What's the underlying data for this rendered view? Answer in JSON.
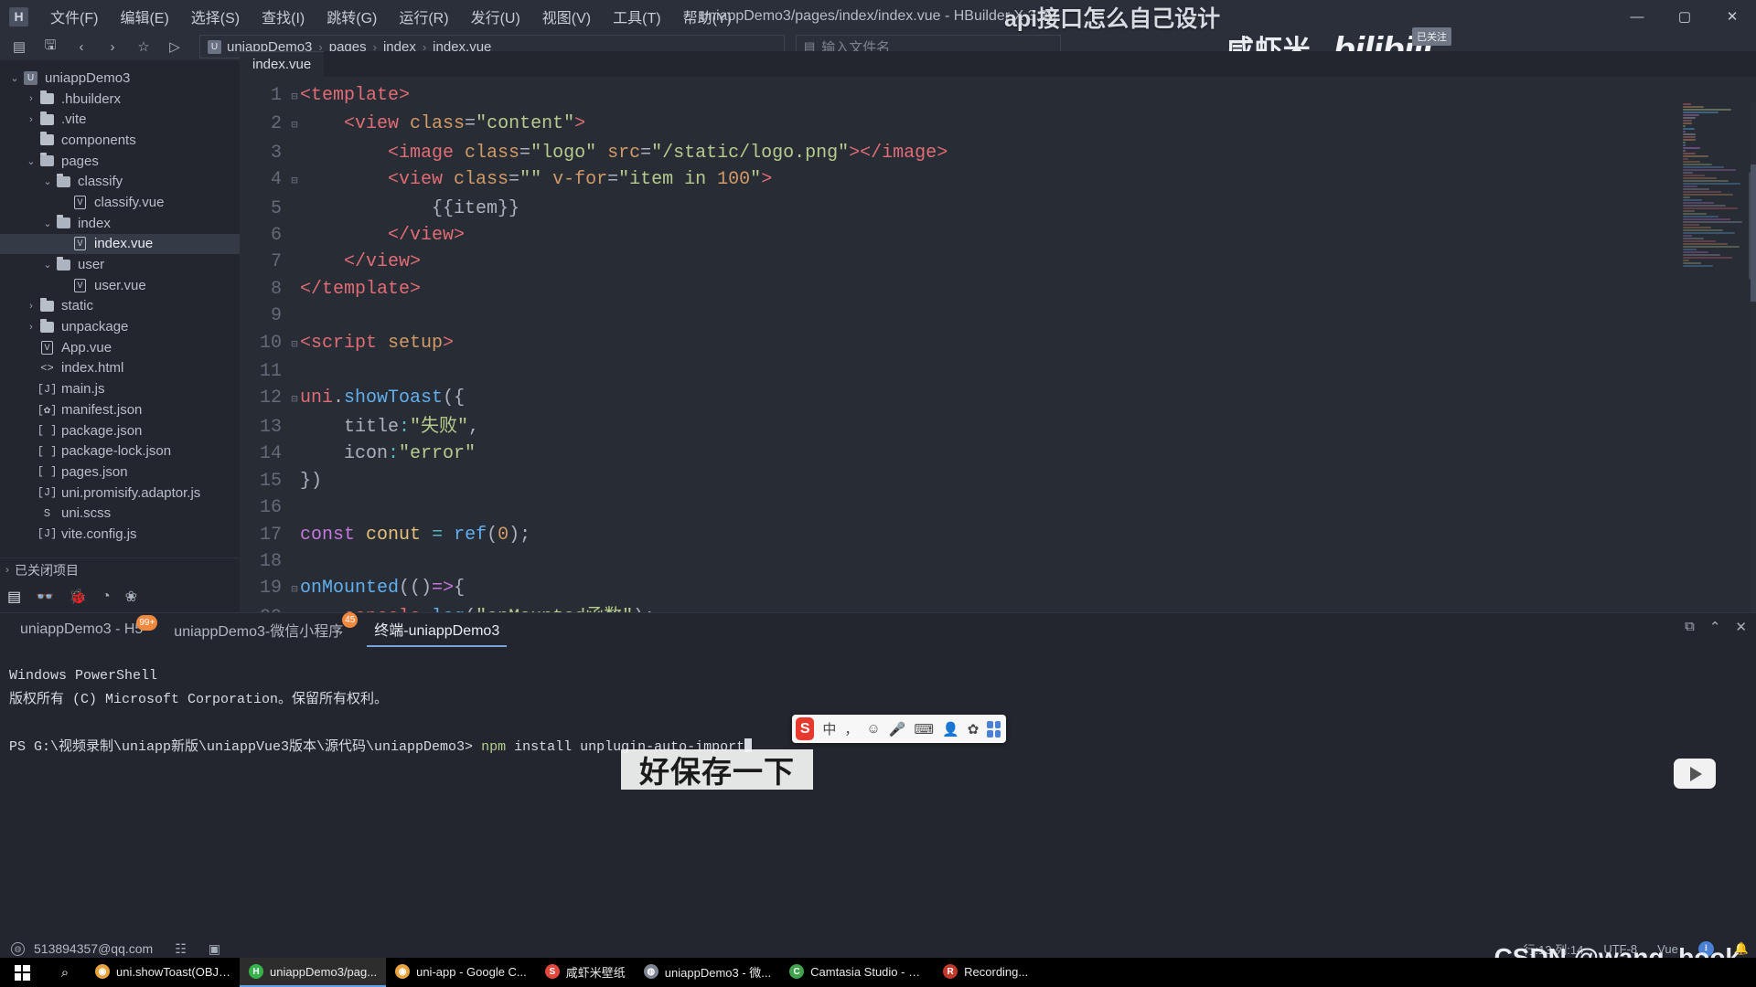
{
  "titlebar": {
    "logo": "H",
    "window_title": "uniappDemo3/pages/index/index.vue - HBuilder X 3.98",
    "overlay_title": "api接口怎么自己设计",
    "menus": [
      "文件(F)",
      "编辑(E)",
      "选择(S)",
      "查找(I)",
      "跳转(G)",
      "运行(R)",
      "发行(U)",
      "视图(V)",
      "工具(T)",
      "帮助(Y)"
    ],
    "minimize": "—",
    "maximize": "▢",
    "close": "✕"
  },
  "toolbar": {
    "icons": [
      "sidebar-toggle-icon",
      "save-icon",
      "back-icon",
      "forward-icon",
      "star-icon",
      "run-icon"
    ],
    "glyphs": [
      "▤",
      "🖫",
      "‹",
      "›",
      "☆",
      "▷"
    ],
    "project_icon": "U",
    "breadcrumb": [
      "uniappDemo3",
      "pages",
      "index",
      "index.vue"
    ],
    "breadcrumb_sep": "›",
    "filename_icon": "▤",
    "filename_placeholder": "输入文件名"
  },
  "brand": {
    "cn_text": "咸虾米_",
    "bili_text": "bilibili",
    "badge": "已关注"
  },
  "sidebar": {
    "tree": [
      {
        "depth": 0,
        "arrow": "⌄",
        "icon": "project-icon",
        "glyph": "U",
        "label": "uniappDemo3",
        "selected": false
      },
      {
        "depth": 1,
        "arrow": "›",
        "icon": "folder-icon",
        "glyph": "",
        "label": ".hbuilderx",
        "selected": false
      },
      {
        "depth": 1,
        "arrow": "›",
        "icon": "folder-icon",
        "glyph": "",
        "label": ".vite",
        "selected": false
      },
      {
        "depth": 1,
        "arrow": "",
        "icon": "folder-icon",
        "glyph": "",
        "label": "components",
        "selected": false
      },
      {
        "depth": 1,
        "arrow": "⌄",
        "icon": "folder-icon",
        "glyph": "",
        "label": "pages",
        "selected": false
      },
      {
        "depth": 2,
        "arrow": "⌄",
        "icon": "folder-icon",
        "glyph": "",
        "label": "classify",
        "selected": false
      },
      {
        "depth": 3,
        "arrow": "",
        "icon": "vue-file-icon",
        "glyph": "V",
        "label": "classify.vue",
        "selected": false
      },
      {
        "depth": 2,
        "arrow": "⌄",
        "icon": "folder-icon",
        "glyph": "",
        "label": "index",
        "selected": false
      },
      {
        "depth": 3,
        "arrow": "",
        "icon": "vue-file-icon",
        "glyph": "V",
        "label": "index.vue",
        "selected": true
      },
      {
        "depth": 2,
        "arrow": "⌄",
        "icon": "folder-icon",
        "glyph": "",
        "label": "user",
        "selected": false
      },
      {
        "depth": 3,
        "arrow": "",
        "icon": "vue-file-icon",
        "glyph": "V",
        "label": "user.vue",
        "selected": false
      },
      {
        "depth": 1,
        "arrow": "›",
        "icon": "folder-icon",
        "glyph": "",
        "label": "static",
        "selected": false
      },
      {
        "depth": 1,
        "arrow": "›",
        "icon": "folder-icon",
        "glyph": "",
        "label": "unpackage",
        "selected": false
      },
      {
        "depth": 1,
        "arrow": "",
        "icon": "vue-file-icon",
        "glyph": "V",
        "label": "App.vue",
        "selected": false
      },
      {
        "depth": 1,
        "arrow": "",
        "icon": "html-file-icon",
        "glyph": "<>",
        "label": "index.html",
        "selected": false
      },
      {
        "depth": 1,
        "arrow": "",
        "icon": "js-file-icon",
        "glyph": "[J]",
        "label": "main.js",
        "selected": false
      },
      {
        "depth": 1,
        "arrow": "",
        "icon": "json-gear-icon",
        "glyph": "[✿]",
        "label": "manifest.json",
        "selected": false
      },
      {
        "depth": 1,
        "arrow": "",
        "icon": "json-file-icon",
        "glyph": "[ ]",
        "label": "package.json",
        "selected": false
      },
      {
        "depth": 1,
        "arrow": "",
        "icon": "json-file-icon",
        "glyph": "[ ]",
        "label": "package-lock.json",
        "selected": false
      },
      {
        "depth": 1,
        "arrow": "",
        "icon": "json-file-icon",
        "glyph": "[ ]",
        "label": "pages.json",
        "selected": false
      },
      {
        "depth": 1,
        "arrow": "",
        "icon": "js-file-icon",
        "glyph": "[J]",
        "label": "uni.promisify.adaptor.js",
        "selected": false
      },
      {
        "depth": 1,
        "arrow": "",
        "icon": "scss-file-icon",
        "glyph": "S",
        "label": "uni.scss",
        "selected": false
      },
      {
        "depth": 1,
        "arrow": "",
        "icon": "js-file-icon",
        "glyph": "[J]",
        "label": "vite.config.js",
        "selected": false
      }
    ],
    "closed_projects": {
      "arrow": "›",
      "label": "已关闭项目"
    },
    "tools": [
      {
        "name": "explorer-icon",
        "glyph": "▤"
      },
      {
        "name": "search-icon",
        "glyph": "👓"
      },
      {
        "name": "debug-icon",
        "glyph": "🐞"
      },
      {
        "name": "terminal-icon",
        "glyph": "◔"
      },
      {
        "name": "extension-icon",
        "glyph": "❀"
      }
    ]
  },
  "editor": {
    "tab_label": "index.vue",
    "lines": [
      {
        "n": "1",
        "fold": "⊟",
        "tokens": [
          {
            "t": "tag",
            "v": "<template>"
          }
        ]
      },
      {
        "n": "2",
        "fold": "⊟",
        "tokens": [
          {
            "t": "plain",
            "v": "    "
          },
          {
            "t": "tag",
            "v": "<view "
          },
          {
            "t": "attr",
            "v": "class"
          },
          {
            "t": "punc",
            "v": "="
          },
          {
            "t": "str",
            "v": "\"content\""
          },
          {
            "t": "tag",
            "v": ">"
          }
        ]
      },
      {
        "n": "3",
        "fold": "",
        "tokens": [
          {
            "t": "plain",
            "v": "        "
          },
          {
            "t": "tag",
            "v": "<image "
          },
          {
            "t": "attr",
            "v": "class"
          },
          {
            "t": "punc",
            "v": "="
          },
          {
            "t": "str",
            "v": "\"logo\""
          },
          {
            "t": "plain",
            "v": " "
          },
          {
            "t": "attr",
            "v": "src"
          },
          {
            "t": "punc",
            "v": "="
          },
          {
            "t": "str",
            "v": "\"/static/logo.png\""
          },
          {
            "t": "tag",
            "v": "></image>"
          }
        ]
      },
      {
        "n": "4",
        "fold": "⊟",
        "tokens": [
          {
            "t": "plain",
            "v": "        "
          },
          {
            "t": "tag",
            "v": "<view "
          },
          {
            "t": "attr",
            "v": "class"
          },
          {
            "t": "punc",
            "v": "="
          },
          {
            "t": "str",
            "v": "\"\""
          },
          {
            "t": "plain",
            "v": " "
          },
          {
            "t": "attr",
            "v": "v-for"
          },
          {
            "t": "punc",
            "v": "="
          },
          {
            "t": "str",
            "v": "\"item in "
          },
          {
            "t": "num",
            "v": "100"
          },
          {
            "t": "str",
            "v": "\""
          },
          {
            "t": "tag",
            "v": ">"
          }
        ]
      },
      {
        "n": "5",
        "fold": "",
        "tokens": [
          {
            "t": "plain",
            "v": "            {{item}}"
          }
        ]
      },
      {
        "n": "6",
        "fold": "",
        "tokens": [
          {
            "t": "plain",
            "v": "        "
          },
          {
            "t": "tag",
            "v": "</view>"
          }
        ]
      },
      {
        "n": "7",
        "fold": "",
        "tokens": [
          {
            "t": "plain",
            "v": "    "
          },
          {
            "t": "tag",
            "v": "</view>"
          }
        ]
      },
      {
        "n": "8",
        "fold": "",
        "tokens": [
          {
            "t": "tag",
            "v": "</template>"
          }
        ]
      },
      {
        "n": "9",
        "fold": "",
        "tokens": [
          {
            "t": "plain",
            "v": ""
          }
        ]
      },
      {
        "n": "10",
        "fold": "⊟",
        "tokens": [
          {
            "t": "tag",
            "v": "<script "
          },
          {
            "t": "attr",
            "v": "setup"
          },
          {
            "t": "tag",
            "v": ">"
          }
        ]
      },
      {
        "n": "11",
        "fold": "",
        "tokens": [
          {
            "t": "plain",
            "v": ""
          }
        ]
      },
      {
        "n": "12",
        "fold": "⊟",
        "tokens": [
          {
            "t": "tag",
            "v": "uni"
          },
          {
            "t": "punc",
            "v": "."
          },
          {
            "t": "fn",
            "v": "showToast"
          },
          {
            "t": "punc",
            "v": "({"
          }
        ]
      },
      {
        "n": "13",
        "fold": "",
        "tokens": [
          {
            "t": "plain",
            "v": "    "
          },
          {
            "t": "plain",
            "v": "title"
          },
          {
            "t": "op",
            "v": ":"
          },
          {
            "t": "str",
            "v": "\"失败\""
          },
          {
            "t": "punc",
            "v": ","
          }
        ]
      },
      {
        "n": "14",
        "fold": "",
        "tokens": [
          {
            "t": "plain",
            "v": "    "
          },
          {
            "t": "plain",
            "v": "icon"
          },
          {
            "t": "op",
            "v": ":"
          },
          {
            "t": "str",
            "v": "\"error\""
          }
        ]
      },
      {
        "n": "15",
        "fold": "",
        "tokens": [
          {
            "t": "punc",
            "v": "})"
          }
        ]
      },
      {
        "n": "16",
        "fold": "",
        "tokens": [
          {
            "t": "plain",
            "v": ""
          }
        ]
      },
      {
        "n": "17",
        "fold": "",
        "tokens": [
          {
            "t": "kw",
            "v": "const"
          },
          {
            "t": "plain",
            "v": " "
          },
          {
            "t": "var",
            "v": "conut"
          },
          {
            "t": "plain",
            "v": " "
          },
          {
            "t": "op",
            "v": "="
          },
          {
            "t": "plain",
            "v": " "
          },
          {
            "t": "fn",
            "v": "ref"
          },
          {
            "t": "punc",
            "v": "("
          },
          {
            "t": "num",
            "v": "0"
          },
          {
            "t": "punc",
            "v": ");"
          }
        ]
      },
      {
        "n": "18",
        "fold": "",
        "tokens": [
          {
            "t": "plain",
            "v": ""
          }
        ]
      },
      {
        "n": "19",
        "fold": "⊟",
        "tokens": [
          {
            "t": "fn",
            "v": "onMounted"
          },
          {
            "t": "punc",
            "v": "(()"
          },
          {
            "t": "kw",
            "v": "=>"
          },
          {
            "t": "punc",
            "v": "{"
          }
        ]
      },
      {
        "n": "20",
        "fold": "",
        "tokens": [
          {
            "t": "plain",
            "v": "    "
          },
          {
            "t": "tag",
            "v": "console"
          },
          {
            "t": "punc",
            "v": "."
          },
          {
            "t": "fn",
            "v": "log"
          },
          {
            "t": "punc",
            "v": "("
          },
          {
            "t": "str",
            "v": "\"onMounted函数\""
          },
          {
            "t": "punc",
            "v": ");"
          }
        ]
      }
    ]
  },
  "panel": {
    "tabs": [
      {
        "label": "uniappDemo3 - H5",
        "badge": "99+",
        "active": false
      },
      {
        "label": "uniappDemo3-微信小程序",
        "badge": "45",
        "active": false
      },
      {
        "label": "终端-uniappDemo3",
        "badge": "",
        "active": true
      }
    ],
    "actions": [
      {
        "name": "new-terminal-icon",
        "glyph": "⧉"
      },
      {
        "name": "collapse-icon",
        "glyph": "⌃"
      },
      {
        "name": "close-panel-icon",
        "glyph": "✕"
      }
    ],
    "terminal": {
      "line1": "Windows PowerShell",
      "line2": "版权所有 (C) Microsoft Corporation。保留所有权利。",
      "prompt": "PS G:\\视频录制\\uniapp新版\\uniappVue3版本\\源代码\\uniappDemo3> ",
      "command_pkg": "npm",
      "command_rest": " install unplugin-auto-import"
    }
  },
  "ime": {
    "logo": "S",
    "mode": "中",
    "punct": "，",
    "emoji": "☺",
    "mic": "🎤",
    "keyboard": "⌨",
    "user": "👤",
    "flower": "✿",
    "apps": "grid-icon"
  },
  "subtitle": {
    "text": "好保存一下"
  },
  "statusbar": {
    "account": "513894357@qq.com",
    "icons": [
      {
        "name": "list-icon",
        "glyph": "☷"
      },
      {
        "name": "console-icon",
        "glyph": "▣"
      }
    ],
    "position": "行:13  列:14",
    "encoding": "UTF-8",
    "language": "Vue",
    "sync_icon": "⭳",
    "bell_icon": "🔔",
    "watermark": "CSDN @wang_book"
  },
  "taskbar": {
    "start_icon": "windows-logo-icon",
    "search_icon": "⌕",
    "tasks": [
      {
        "label": "uni.showToast(OBJE...",
        "icon": "chrome-icon",
        "color": "#e8a33d",
        "glyph": "◉",
        "active": false
      },
      {
        "label": "uniappDemo3/pag...",
        "icon": "hbuilderx-icon",
        "color": "#35b34a",
        "glyph": "H",
        "active": true
      },
      {
        "label": "uni-app - Google C...",
        "icon": "chrome-icon",
        "color": "#e8a33d",
        "glyph": "◉",
        "active": false
      },
      {
        "label": "咸虾米壁纸",
        "icon": "wallpaper-icon",
        "color": "#e1483b",
        "glyph": "S",
        "active": false
      },
      {
        "label": "uniappDemo3 - 微...",
        "icon": "wechat-dev-icon",
        "color": "#7d8491",
        "glyph": "◍",
        "active": false
      },
      {
        "label": "Camtasia Studio - U...",
        "icon": "camtasia-icon",
        "color": "#3fa34d",
        "glyph": "C",
        "active": false
      },
      {
        "label": "Recording...",
        "icon": "recording-icon",
        "color": "#c0392b",
        "glyph": "R",
        "active": false
      }
    ]
  },
  "colors": {
    "titlebar_bg": "#2b2f3a",
    "sidebar_bg": "#23262e",
    "editor_bg": "#282c34",
    "accent": "#7aa2d6",
    "badge": "#f0883e"
  }
}
